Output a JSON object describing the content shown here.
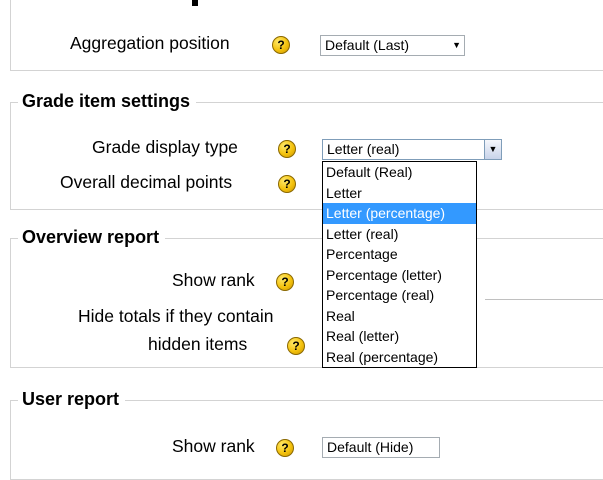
{
  "section_top": {
    "aggregation_position": {
      "label": "Aggregation position",
      "value": "Default (Last)"
    }
  },
  "grade_item_settings": {
    "legend": "Grade item settings",
    "grade_display_type": {
      "label": "Grade display type",
      "value": "Letter (real)",
      "options": [
        "Default (Real)",
        "Letter",
        "Letter (percentage)",
        "Letter (real)",
        "Percentage",
        "Percentage (letter)",
        "Percentage (real)",
        "Real",
        "Real (letter)",
        "Real (percentage)"
      ],
      "highlighted_option": "Letter (percentage)"
    },
    "overall_decimal_points": {
      "label": "Overall decimal points"
    }
  },
  "overview_report": {
    "legend": "Overview report",
    "show_rank": {
      "label": "Show rank"
    },
    "hide_totals": {
      "label_line1": "Hide totals if they contain",
      "label_line2": "hidden items"
    }
  },
  "user_report": {
    "legend": "User report",
    "show_rank": {
      "label": "Show rank",
      "value": "Default (Hide)"
    }
  },
  "help_icon": {
    "glyph": "?",
    "color": "#f4c20d"
  },
  "colors": {
    "highlight": "#3399ff",
    "border": "#d3d3d3"
  }
}
